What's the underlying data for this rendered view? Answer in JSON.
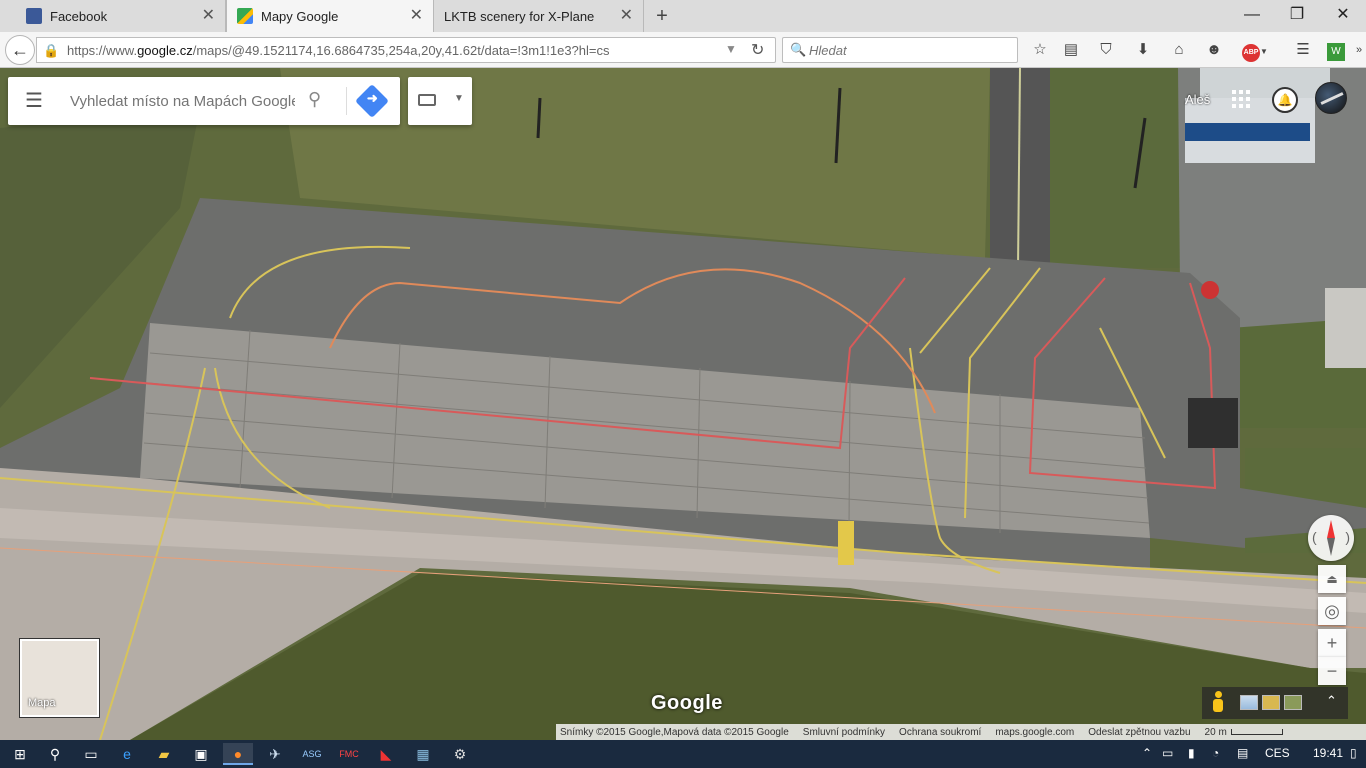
{
  "browser": {
    "tabs": [
      {
        "label": "Facebook",
        "favicon_color": "#3b5998",
        "active": false
      },
      {
        "label": "Mapy Google",
        "favicon_color": "#34a853",
        "active": true
      },
      {
        "label": "LKTB scenery for X-Plane",
        "favicon_color": "",
        "active": false
      }
    ],
    "new_tab_symbol": "+",
    "window": {
      "minimize": "—",
      "restore": "❐",
      "close": "✕"
    },
    "url_prefix": "https://www.",
    "url_host": "google.cz",
    "url_rest": "/maps/@49.1521174,16.6864735,254a,20y,41.62t/data=!3m1!1e3?hl=cs",
    "search_placeholder": "Hledat",
    "toolbar_icons": [
      "star-icon",
      "reading-list-icon",
      "pocket-icon",
      "download-icon",
      "home-icon",
      "emoji-icon",
      "adblock-icon",
      "menu-icon",
      "extension-icon"
    ],
    "adblock_label": "ABP"
  },
  "maps": {
    "search_placeholder": "Vyhledat místo na Mapách Google",
    "user_name": "Aleš",
    "minimap_label": "Mapa",
    "logo": "Google",
    "footer": {
      "imagery": "Snímky ©2015 Google,Mapová data ©2015 Google",
      "terms": "Smluvní podmínky",
      "privacy": "Ochrana soukromí",
      "site": "maps.google.com",
      "feedback": "Odeslat zpětnou vazbu",
      "scale": "20 m"
    },
    "controls": {
      "zoom_in": "+",
      "zoom_out": "−"
    }
  },
  "taskbar": {
    "language": "CES",
    "time": "19:41"
  }
}
